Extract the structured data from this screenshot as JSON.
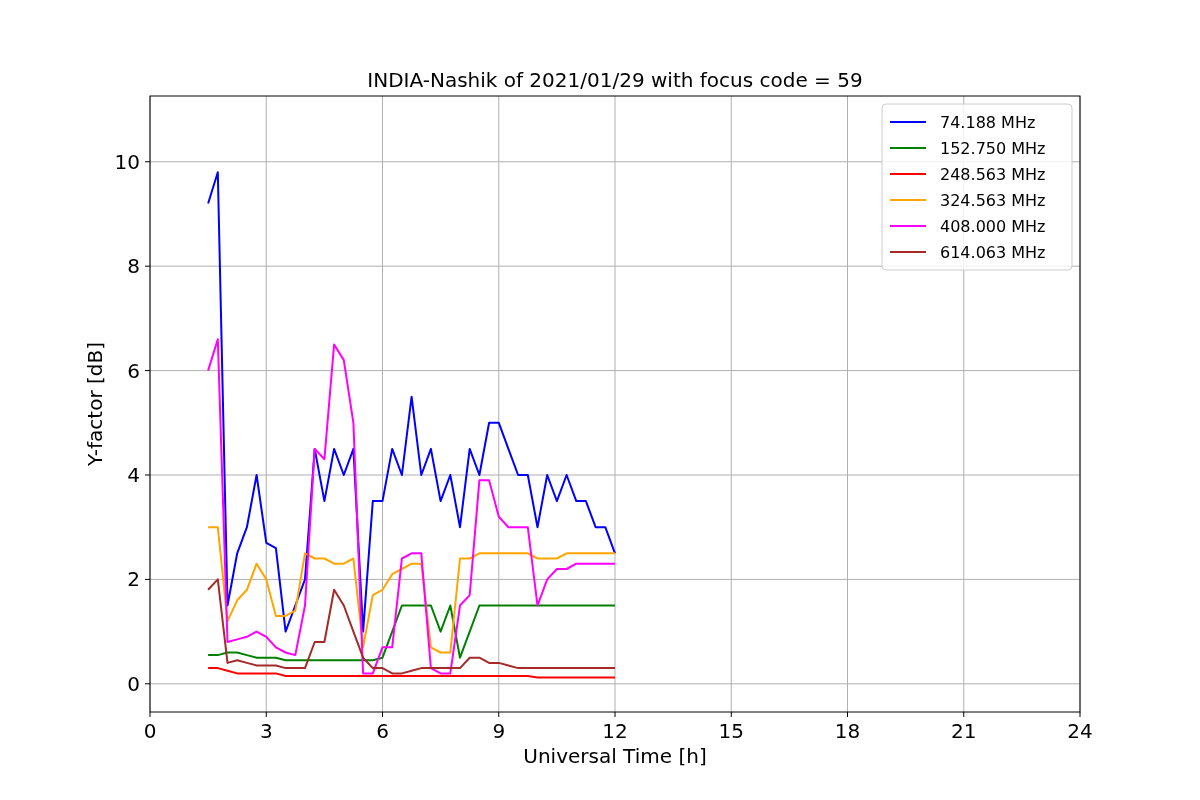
{
  "chart_data": {
    "type": "line",
    "title": "INDIA-Nashik of 2021/01/29 with focus code = 59",
    "xlabel": "Universal Time [h]",
    "ylabel": "Y-factor [dB]",
    "x": [
      1.5,
      1.75,
      2,
      2.25,
      2.5,
      2.75,
      3,
      3.25,
      3.5,
      3.75,
      4,
      4.25,
      4.5,
      4.75,
      5,
      5.25,
      5.5,
      5.75,
      6,
      6.25,
      6.5,
      6.75,
      7,
      7.25,
      7.5,
      7.75,
      8,
      8.25,
      8.5,
      8.75,
      9,
      9.25,
      9.5,
      9.75,
      10,
      10.25,
      10.5,
      10.75,
      11,
      11.25,
      11.5,
      11.75,
      12
    ],
    "series": [
      {
        "name": "74.188 MHz",
        "color": "#0000ff",
        "values": [
          9.2,
          9.8,
          1.5,
          2.5,
          3.0,
          4.0,
          2.7,
          2.6,
          1.0,
          1.5,
          2.0,
          4.5,
          3.5,
          4.5,
          4.0,
          4.5,
          1.0,
          3.5,
          3.5,
          4.5,
          4.0,
          5.5,
          4.0,
          4.5,
          3.5,
          4.0,
          3.0,
          4.5,
          4.0,
          5.0,
          5.0,
          4.5,
          4.0,
          4.0,
          3.0,
          4.0,
          3.5,
          4.0,
          3.5,
          3.5,
          3.0,
          3.0,
          2.5
        ]
      },
      {
        "name": "152.750 MHz",
        "color": "#008000",
        "values": [
          0.55,
          0.55,
          0.6,
          0.6,
          0.55,
          0.5,
          0.5,
          0.5,
          0.45,
          0.45,
          0.45,
          0.45,
          0.45,
          0.45,
          0.45,
          0.45,
          0.45,
          0.45,
          0.5,
          1.0,
          1.5,
          1.5,
          1.5,
          1.5,
          1.0,
          1.5,
          0.5,
          1.0,
          1.5,
          1.5,
          1.5,
          1.5,
          1.5,
          1.5,
          1.5,
          1.5,
          1.5,
          1.5,
          1.5,
          1.5,
          1.5,
          1.5,
          1.5
        ]
      },
      {
        "name": "248.563 MHz",
        "color": "#ff0000",
        "values": [
          0.3,
          0.3,
          0.25,
          0.2,
          0.2,
          0.2,
          0.2,
          0.2,
          0.15,
          0.15,
          0.15,
          0.15,
          0.15,
          0.15,
          0.15,
          0.15,
          0.15,
          0.15,
          0.15,
          0.15,
          0.15,
          0.15,
          0.15,
          0.15,
          0.15,
          0.15,
          0.15,
          0.15,
          0.15,
          0.15,
          0.15,
          0.15,
          0.15,
          0.15,
          0.12,
          0.12,
          0.12,
          0.12,
          0.12,
          0.12,
          0.12,
          0.12,
          0.12
        ]
      },
      {
        "name": "324.563 MHz",
        "color": "#ffa500",
        "values": [
          3.0,
          3.0,
          1.2,
          1.6,
          1.8,
          2.3,
          2.0,
          1.3,
          1.3,
          1.4,
          2.5,
          2.4,
          2.4,
          2.3,
          2.3,
          2.4,
          0.7,
          1.7,
          1.8,
          2.1,
          2.2,
          2.3,
          2.3,
          0.7,
          0.6,
          0.6,
          2.4,
          2.4,
          2.5,
          2.5,
          2.5,
          2.5,
          2.5,
          2.5,
          2.4,
          2.4,
          2.4,
          2.5,
          2.5,
          2.5,
          2.5,
          2.5,
          2.5
        ]
      },
      {
        "name": "408.000 MHz",
        "color": "#ff00ff",
        "values": [
          6.0,
          6.6,
          0.8,
          0.85,
          0.9,
          1.0,
          0.9,
          0.7,
          0.6,
          0.55,
          1.5,
          4.5,
          4.3,
          6.5,
          6.2,
          5.0,
          0.2,
          0.2,
          0.7,
          0.7,
          2.4,
          2.5,
          2.5,
          0.3,
          0.2,
          0.2,
          1.5,
          1.7,
          3.9,
          3.9,
          3.2,
          3.0,
          3.0,
          3.0,
          1.5,
          2.0,
          2.2,
          2.2,
          2.3,
          2.3,
          2.3,
          2.3,
          2.3
        ]
      },
      {
        "name": "614.063 MHz",
        "color": "#a52a2a",
        "values": [
          1.8,
          2.0,
          0.4,
          0.45,
          0.4,
          0.35,
          0.35,
          0.35,
          0.3,
          0.3,
          0.3,
          0.8,
          0.8,
          1.8,
          1.5,
          1.0,
          0.5,
          0.3,
          0.3,
          0.2,
          0.2,
          0.25,
          0.3,
          0.3,
          0.3,
          0.3,
          0.3,
          0.5,
          0.5,
          0.4,
          0.4,
          0.35,
          0.3,
          0.3,
          0.3,
          0.3,
          0.3,
          0.3,
          0.3,
          0.3,
          0.3,
          0.3,
          0.3
        ]
      }
    ],
    "grid": true,
    "legend": "upper right",
    "xlim": [
      0,
      24
    ],
    "ylim": [
      -0.54,
      11.26
    ],
    "xticks": [
      0,
      3,
      6,
      9,
      12,
      15,
      18,
      21,
      24
    ],
    "yticks": [
      0,
      2,
      4,
      6,
      8,
      10
    ]
  }
}
